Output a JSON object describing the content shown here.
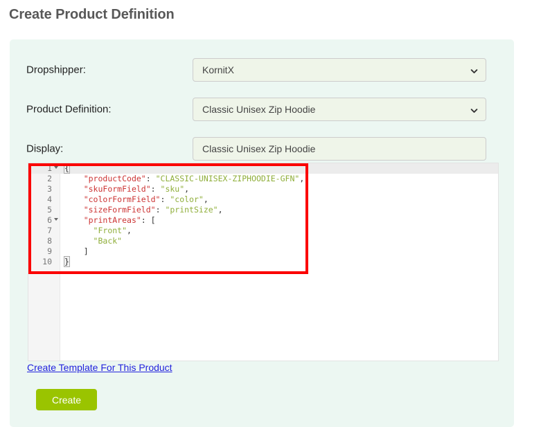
{
  "page": {
    "title": "Create Product Definition"
  },
  "form": {
    "fields": [
      {
        "label": "Dropshipper:",
        "control": "select",
        "value": "KornitX",
        "icon": "chevron-down-icon",
        "name": "dropshipper"
      },
      {
        "label": "Product Definition:",
        "control": "select",
        "value": "Classic Unisex Zip Hoodie",
        "icon": "chevron-down-icon",
        "name": "product-definition"
      },
      {
        "label": "Display:",
        "control": "text",
        "value": "Classic Unisex Zip Hoodie",
        "placeholder": "",
        "name": "display"
      }
    ],
    "link": {
      "label": "Create Template For This Product"
    },
    "submit": {
      "label": "Create"
    }
  },
  "editor": {
    "language": "json",
    "line_numbers": [
      "1",
      "2",
      "3",
      "4",
      "5",
      "6",
      "7",
      "8",
      "9",
      "10"
    ],
    "fold_arrow_lines": [
      1,
      6
    ],
    "active_line": 1,
    "lines": [
      "{",
      "    \"productCode\": \"CLASSIC-UNISEX-ZIPHOODIE-GFN\",",
      "    \"skuFormField\": \"sku\",",
      "    \"colorFormField\": \"color\",",
      "    \"sizeFormField\": \"printSize\",",
      "    \"printAreas\": [",
      "      \"Front\",",
      "      \"Back\"",
      "    ]",
      "}"
    ],
    "content": {
      "productCode": "CLASSIC-UNISEX-ZIPHOODIE-GFN",
      "skuFormField": "sku",
      "colorFormField": "color",
      "sizeFormField": "printSize",
      "printAreas": [
        "Front",
        "Back"
      ]
    }
  },
  "colors": {
    "panel_background": "#ecf7f2",
    "field_background": "#eff5e9",
    "button_green": "#9ac400",
    "link_blue": "#2222dd",
    "highlight_red": "#fb0000",
    "json_key": "#cc3333",
    "json_string": "#8fae3a"
  }
}
